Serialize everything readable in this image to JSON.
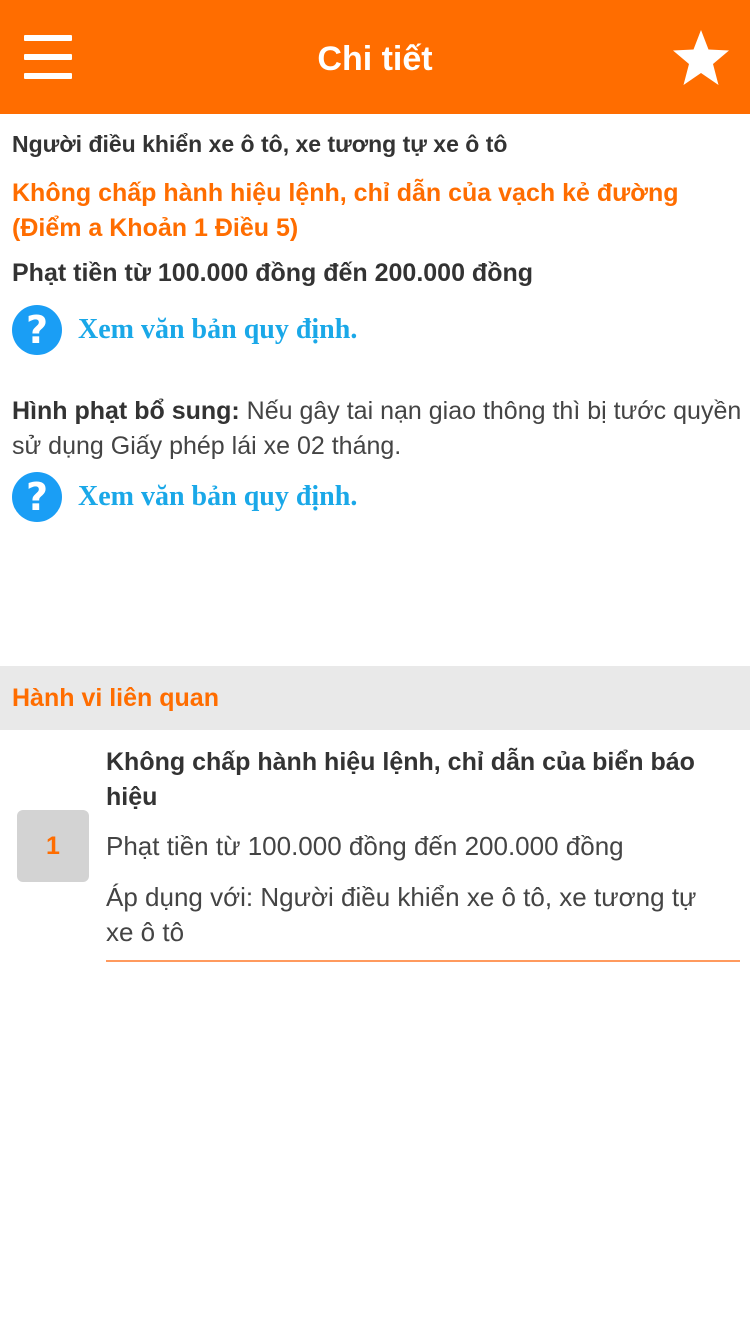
{
  "header": {
    "title": "Chi tiết",
    "menu_icon": "hamburger-menu-icon",
    "favorite_icon": "star-icon",
    "color": "#ff6d00"
  },
  "detail": {
    "subject": "Người điều khiển xe ô tô, xe tương tự xe ô tô",
    "violation_line1": "Không chấp hành hiệu lệnh, chỉ dẫn của vạch kẻ đường",
    "violation_line2": "(Điểm a Khoản 1 Điều 5)",
    "fine": "Phạt tiền từ 100.000 đồng đến 200.000 đồng",
    "doc_link_label": "Xem văn bản quy định.",
    "extra_penalty_label": "Hình phạt bổ sung:",
    "extra_penalty_text": " Nếu gây tai nạn giao thông thì bị tước quyền sử dụng Giấy phép lái xe 02 tháng.",
    "doc_link2_label": "Xem văn bản quy định."
  },
  "related": {
    "section_title": "Hành vi liên quan",
    "items": [
      {
        "number": "1",
        "title": "Không chấp hành hiệu lệnh, chỉ dẫn của biển báo hiệu",
        "fine": "Phạt tiền từ 100.000 đồng đến 200.000 đồng",
        "apply": "Áp dụng với: Người điều khiển xe ô tô, xe tương tự xe ô tô"
      }
    ]
  }
}
